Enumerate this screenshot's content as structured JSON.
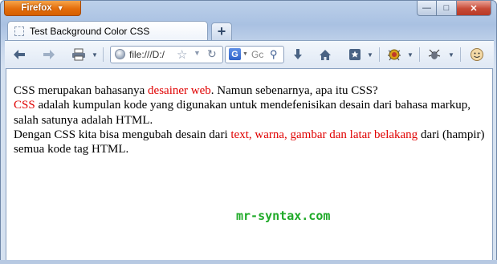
{
  "window": {
    "app_button_label": "Firefox",
    "controls": {
      "minimize": "—",
      "maximize": "□",
      "close": "✕"
    }
  },
  "tabs": [
    {
      "title": "Test Background Color CSS",
      "active": true
    }
  ],
  "new_tab_label": "+",
  "toolbar": {
    "back_icon": "back-arrow-icon",
    "forward_icon": "forward-arrow-icon",
    "print_icon": "printer-icon",
    "url": "file:///D:/",
    "search_engine": "G",
    "search_placeholder": "Gc",
    "downloads_icon": "download-arrow-icon",
    "home_icon": "home-icon",
    "bookmarks_icon": "bookmarks-icon",
    "addon1_icon": "bug-icon",
    "addon2_icon": "firebug-icon",
    "addon3_icon": "smiley-icon"
  },
  "page": {
    "line1_a": "CSS merupakan bahasanya ",
    "line1_red": "desainer web",
    "line1_b": ". Namun sebenarnya, apa itu CSS?",
    "line2_red": "CSS",
    "line2_a": " adalah kumpulan kode yang digunakan untuk mendefenisikan desain dari bahasa markup, salah satunya adalah HTML.",
    "line3_a": "Dengan CSS kita bisa mengubah desain dari ",
    "line3_red": "text, warna, gambar dan latar belakang",
    "line3_b": " dari (hampir) semua kode tag HTML.",
    "watermark": "mr-syntax.com"
  },
  "colors": {
    "highlight_red": "#e00000",
    "watermark_green": "#1faa28",
    "firefox_orange": "#e46d0b"
  }
}
